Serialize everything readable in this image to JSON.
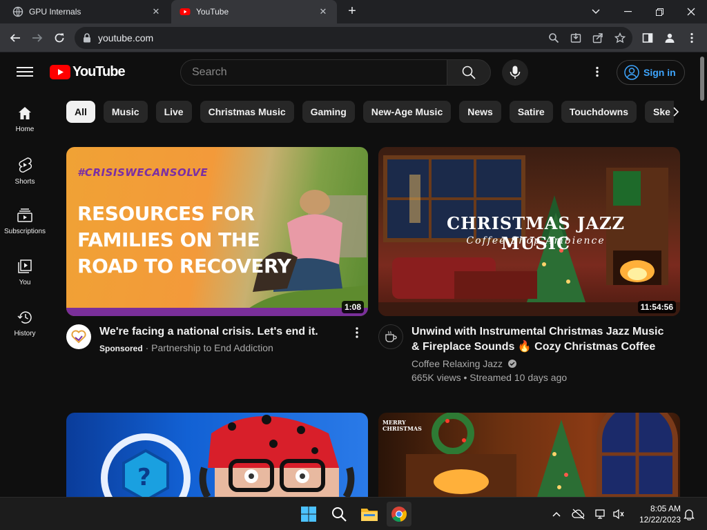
{
  "browser": {
    "tabs": [
      {
        "title": "GPU Internals",
        "active": false
      },
      {
        "title": "YouTube",
        "active": true
      }
    ],
    "address": "youtube.com"
  },
  "youtube": {
    "logo_text": "YouTube",
    "search_placeholder": "Search",
    "sign_in_label": "Sign in",
    "sidebar": [
      {
        "label": "Home",
        "icon": "home-icon"
      },
      {
        "label": "Shorts",
        "icon": "shorts-icon"
      },
      {
        "label": "Subscriptions",
        "icon": "subscriptions-icon"
      },
      {
        "label": "You",
        "icon": "you-icon"
      },
      {
        "label": "History",
        "icon": "history-icon"
      }
    ],
    "chips": [
      "All",
      "Music",
      "Live",
      "Christmas Music",
      "Gaming",
      "New-Age Music",
      "News",
      "Satire",
      "Touchdowns",
      "Ske"
    ],
    "selected_chip": "All",
    "videos": [
      {
        "title": "We're facing a national crisis. Let's end it.",
        "sponsored_label": "Sponsored",
        "channel": "Partnership to End Addiction",
        "duration": "1:08",
        "thumb_hashtag": "#CRISISWECANSOLVE",
        "thumb_lines": [
          "RESOURCES FOR",
          "FAMILIES ON THE",
          "ROAD TO RECOVERY"
        ]
      },
      {
        "title": "Unwind with Instrumental Christmas Jazz Music & Fireplace Sounds 🔥 Cozy Christmas Coffee Shop…",
        "channel": "Coffee Relaxing Jazz",
        "stats": "665K views • Streamed 10 days ago",
        "duration": "11:54:56",
        "thumb_title": "CHRISTMAS JAZZ MUSIC",
        "thumb_subtitle": "Coffee Shop Ambience"
      },
      {
        "title": ""
      },
      {
        "title": "",
        "thumb_badge": "MERRY CHRISTMAS"
      }
    ]
  },
  "taskbar": {
    "time": "8:05 AM",
    "date": "12/22/2023"
  },
  "colors": {
    "yt_red": "#ff0000",
    "link_blue": "#3ea6ff",
    "bg": "#0f0f0f",
    "chip": "#272727"
  }
}
